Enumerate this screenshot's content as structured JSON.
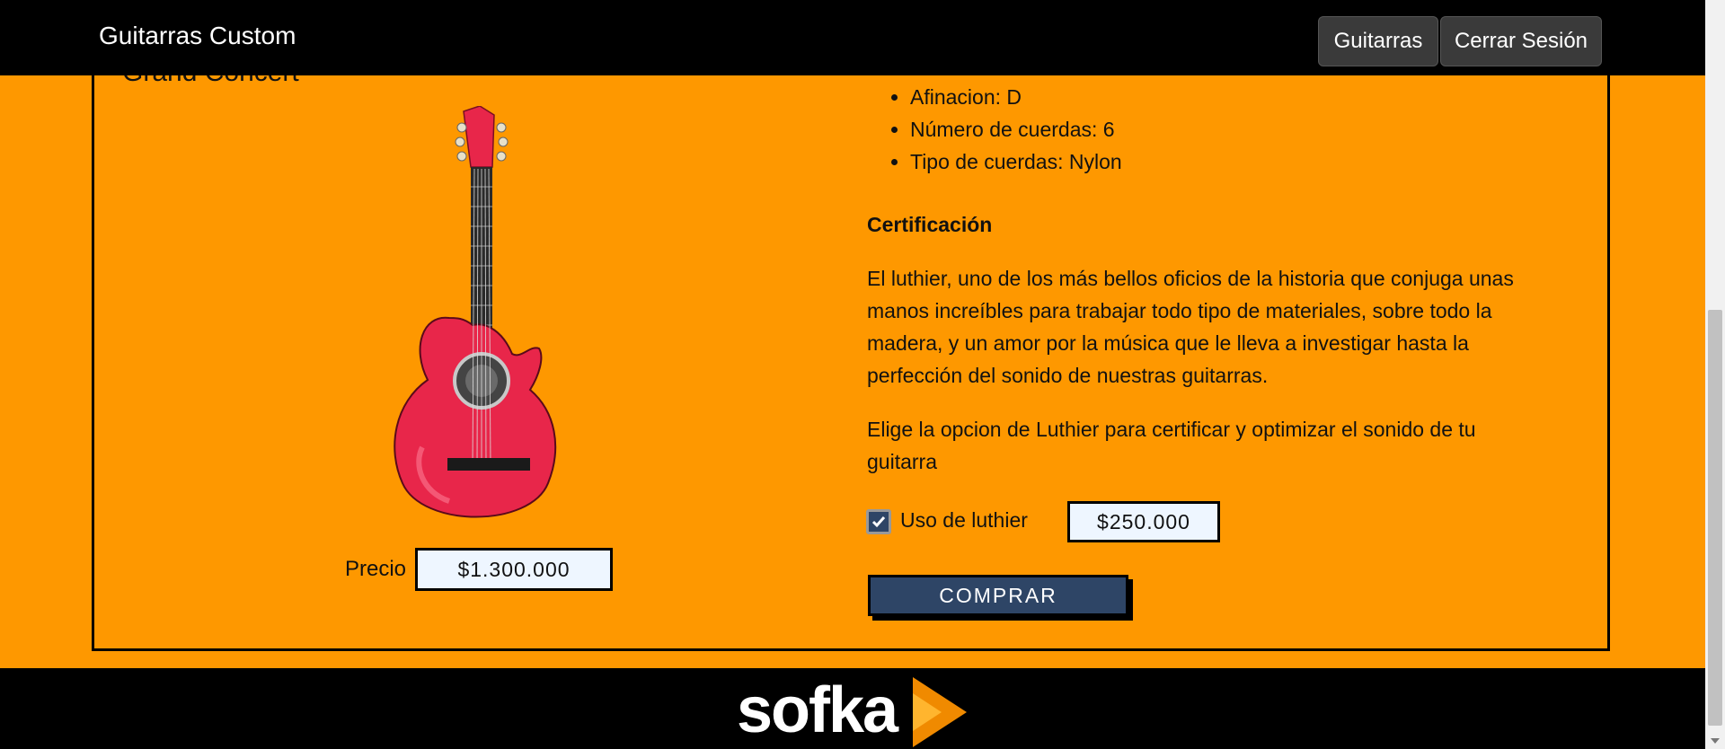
{
  "navbar": {
    "brand": "Guitarras Custom",
    "guitarras_label": "Guitarras",
    "logout_label": "Cerrar Sesión"
  },
  "product": {
    "model_title": "Grand Concert",
    "price_label": "Precio",
    "price_value": "$1.300.000",
    "specs": [
      "Afinacion: D",
      "Número de cuerdas: 6",
      "Tipo de cuerdas: Nylon"
    ],
    "certification": {
      "title": "Certificación",
      "paragraph_1": "El luthier, uno de los más bellos oficios de la historia que conjuga unas manos increíbles para trabajar todo tipo de materiales, sobre todo la madera, y un amor por la música que le lleva a investigar hasta la perfección del sonido de nuestras guitarras.",
      "paragraph_2": "Elige la opcion de Luthier para certificar y optimizar el sonido de tu guitarra",
      "checkbox_label": "Uso de luthier",
      "checkbox_checked": true,
      "luthier_price": "$250.000"
    },
    "buy_label": "COMPRAR"
  },
  "footer": {
    "logo_text": "sofka"
  },
  "colors": {
    "background": "#fe9800",
    "navbar": "#000000",
    "button_blue": "#2e4566",
    "guitar_red": "#e8264a"
  }
}
